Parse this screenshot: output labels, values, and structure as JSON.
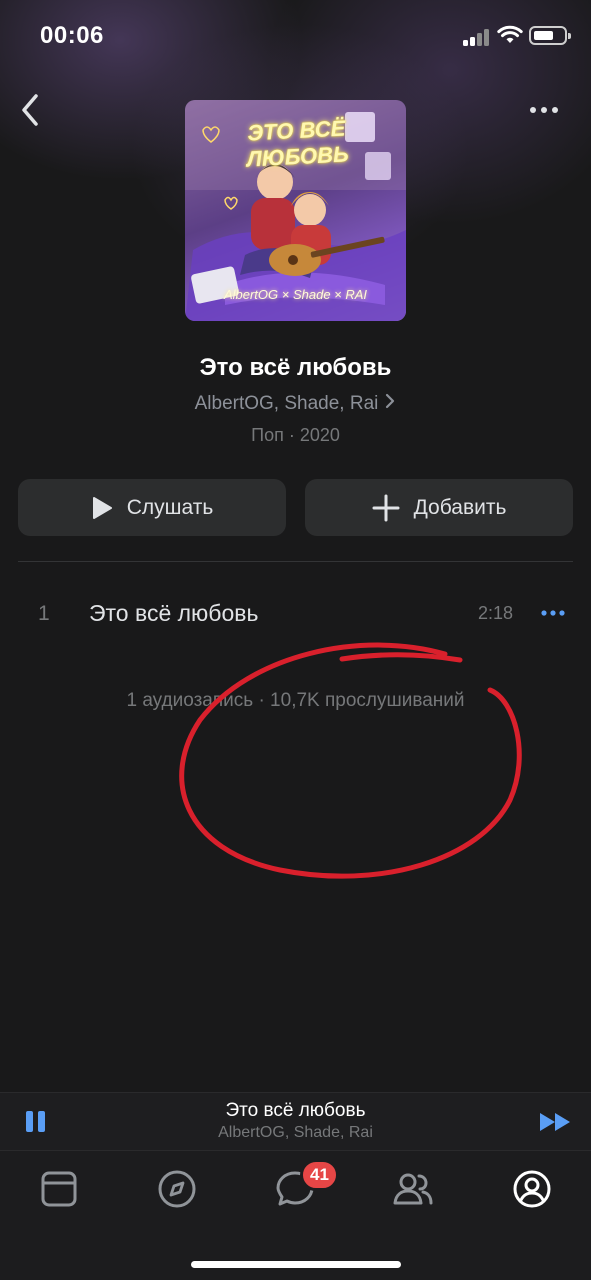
{
  "status_bar": {
    "time": "00:06"
  },
  "album": {
    "cover_title": "ЭТО ВСЁ ЛЮБОВЬ",
    "cover_caption": "AlbertOG × Shade × RAI",
    "title": "Это всё любовь",
    "artists": "AlbertOG, Shade, Rai",
    "meta": "Поп · 2020"
  },
  "actions": {
    "listen_label": "Слушать",
    "add_label": "Добавить"
  },
  "tracks": [
    {
      "number": "1",
      "title": "Это всё любовь",
      "duration": "2:18"
    }
  ],
  "summary": "1 аудиозапись · 10,7K прослушиваний",
  "mini_player": {
    "title": "Это всё любовь",
    "artists": "AlbertOG, Shade, Rai"
  },
  "tab_bar": {
    "tabs": [
      "news-icon",
      "discover-icon",
      "messages-icon",
      "friends-icon",
      "profile-icon"
    ],
    "messages_badge": "41"
  },
  "colors": {
    "accent": "#5a9ef5",
    "badge": "#e64646",
    "annotation": "#d9202c"
  }
}
